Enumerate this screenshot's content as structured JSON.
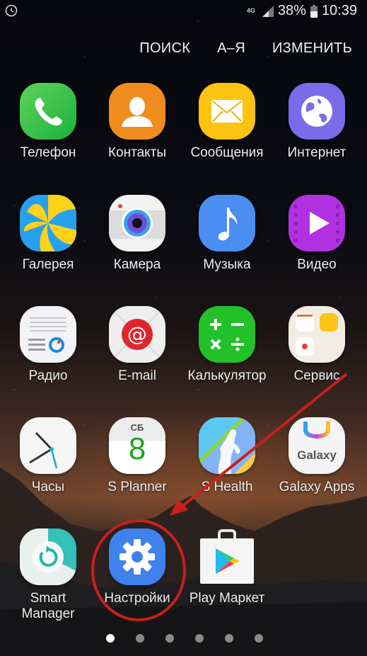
{
  "status_bar": {
    "left_icon": "alarm-clock-icon",
    "network": "4G",
    "signal_icon": "signal-bars-icon",
    "battery_percent": "38%",
    "battery_icon": "battery-icon",
    "time": "10:39"
  },
  "actions": {
    "search": "ПОИСК",
    "sort": "А–Я",
    "edit": "ИЗМЕНИТЬ"
  },
  "apps": [
    {
      "label": "Телефон",
      "icon": "phone-icon"
    },
    {
      "label": "Контакты",
      "icon": "contacts-icon"
    },
    {
      "label": "Сообщения",
      "icon": "messages-icon"
    },
    {
      "label": "Интернет",
      "icon": "internet-icon"
    },
    {
      "label": "Галерея",
      "icon": "gallery-icon"
    },
    {
      "label": "Камера",
      "icon": "camera-icon"
    },
    {
      "label": "Музыка",
      "icon": "music-icon"
    },
    {
      "label": "Видео",
      "icon": "video-icon"
    },
    {
      "label": "Радио",
      "icon": "radio-icon"
    },
    {
      "label": "E-mail",
      "icon": "email-icon"
    },
    {
      "label": "Калькулятор",
      "icon": "calculator-icon"
    },
    {
      "label": "Сервис",
      "icon": "folder-icon"
    },
    {
      "label": "Часы",
      "icon": "clock-icon"
    },
    {
      "label": "S Planner",
      "icon": "calendar-icon",
      "calendar_day": "СБ",
      "calendar_date": "8"
    },
    {
      "label": "S Health",
      "icon": "health-icon"
    },
    {
      "label": "Galaxy Apps",
      "icon": "galaxy-apps-icon",
      "icon_text": "Galaxy"
    },
    {
      "label": "Smart Manager",
      "label_line1": "Smart",
      "label_line2": "Manager",
      "icon": "smart-manager-icon"
    },
    {
      "label": "Настройки",
      "icon": "settings-icon",
      "highlighted": true
    },
    {
      "label": "Play Маркет",
      "icon": "play-store-icon"
    }
  ],
  "page_indicator": {
    "total_pages": 6,
    "current_page": 1
  },
  "annotation": {
    "color": "#c8201c",
    "target": "Настройки"
  }
}
